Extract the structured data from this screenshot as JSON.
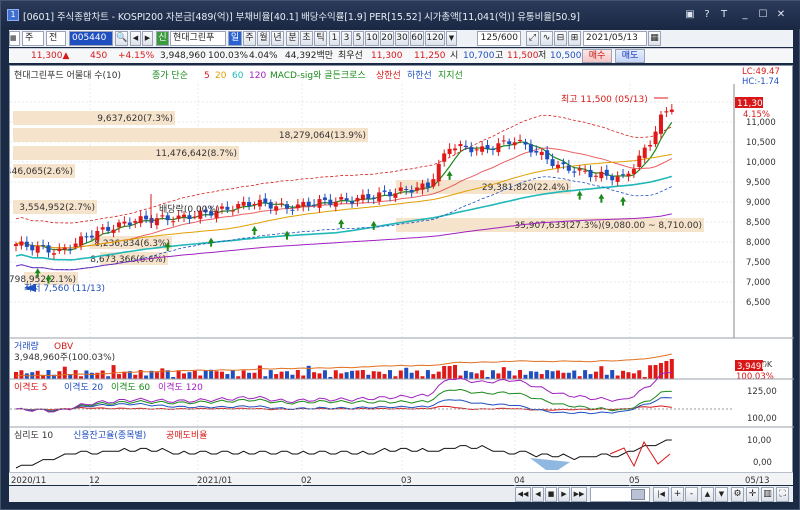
{
  "window": {
    "title": "[0601] 주식종합차트 - KOSPI200 자본금[489(억)] 부채비율[40.1] 배당수익률[1.9] PER[15.52] 시가총액[11,041(억)] 유통비율[50.9]",
    "icon": "1",
    "controls": [
      "▣",
      "?",
      "T",
      "_",
      "☐",
      "✕"
    ]
  },
  "toolbar": {
    "market": "주",
    "mode": "전",
    "code": "005440",
    "search_icon": "search-icon",
    "badge": "신",
    "stock_name": "현대그린푸",
    "period_active": "일",
    "periods": [
      "주",
      "월",
      "년",
      "분",
      "초",
      "틱"
    ],
    "minutes": [
      "1",
      "3",
      "5",
      "10",
      "20",
      "30",
      "60",
      "120"
    ],
    "count": "125/600",
    "date": "2021/05/13"
  },
  "quote": {
    "price": "11,300▲",
    "change": "450",
    "change_pct": "+4.15%",
    "volume": "3,948,960",
    "vol_ratio": "100.03%",
    "turnover": "4.04%",
    "amount": "44,392백만",
    "best_label": "최우선",
    "bid1": "11,300",
    "bid2": "11,250",
    "open_label": "시",
    "open": "10,700",
    "high_label": "고",
    "high": "11,500",
    "low_label": "저",
    "low": "10,500",
    "buy": "매수",
    "sell": "매도"
  },
  "legend": {
    "stock": "현대그린푸드 어물대 수(10)",
    "ma_label": "종가 단순",
    "ma": [
      "5",
      "20",
      "60",
      "120"
    ],
    "ma_colors": [
      "#d81818",
      "#e0a000",
      "#20b8b8",
      "#a020c0"
    ],
    "macd": "MACD-sig와 골든크로스",
    "upper": "상한선",
    "lower": "하한선",
    "support": "지지선"
  },
  "price_axis": {
    "top_labels": [
      "LC:49.47",
      "HC:-1.74"
    ],
    "ticks": [
      "11,500",
      "11,000",
      "10,500",
      "10,000",
      "9,500",
      "9,000",
      "8,500",
      "8,000",
      "7,500",
      "7,000",
      "6,500"
    ],
    "current": "11,300",
    "current_pct": "4.15%"
  },
  "price_zones": [
    {
      "label": "9,637,620(7.3%)"
    },
    {
      "label": "18,279,064(13.9%)"
    },
    {
      "label": "11,476,642(8.7%)"
    },
    {
      "label": "3,446,065(2.6%)"
    },
    {
      "label": "3,554,952(2.7%)"
    },
    {
      "label": "8,236,834(6.3%)"
    },
    {
      "label": "8,673,366(6.6%)"
    },
    {
      "label": "2,798,952(2.1%)"
    },
    {
      "label": "29,381,820(22.4%)"
    },
    {
      "label": "35,907,633(27.3%)(9,080.00 ~ 8,710.00)"
    }
  ],
  "annotations": {
    "max": "최고 11,500 (05/13)",
    "min": "최저 7,560 (11/13)",
    "dividend": "배당락(0.00%)"
  },
  "volume_panel": {
    "labels": [
      "거래량",
      "OBV"
    ],
    "value": "3,948,960주(100.03%)",
    "ticks": [
      "5,000K"
    ],
    "current": "3,949K",
    "pct": "100.03%"
  },
  "disparity_panel": {
    "labels": [
      "이격도 5",
      "이격도 20",
      "이격도 60",
      "이격도 120"
    ],
    "ticks": [
      "125,00",
      "100,00"
    ]
  },
  "psych_panel": {
    "labels": [
      "심리도 10",
      "신용잔고율(종목별)",
      "공매도비율"
    ],
    "ticks": [
      "10,00",
      "0,00"
    ]
  },
  "xaxis": {
    "labels": [
      "2020/11",
      "12",
      "2021/01",
      "02",
      "03",
      "04",
      "05"
    ],
    "end": "05/13"
  },
  "scroll_controls": [
    "◀◀",
    "◀",
    "■",
    "▶",
    "▶▶",
    "|◀",
    "+",
    "-",
    "▲",
    "▼"
  ]
}
